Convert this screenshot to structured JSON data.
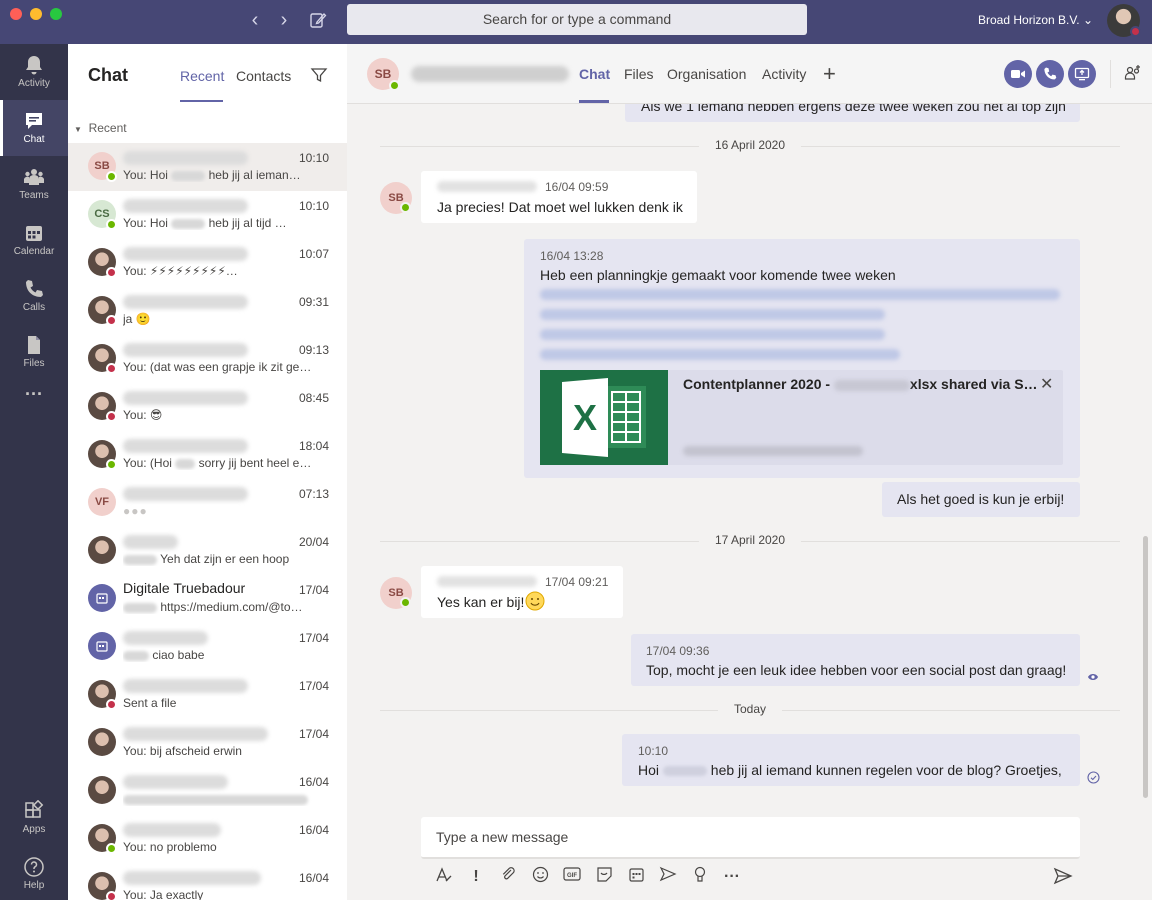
{
  "titlebar": {
    "search_placeholder": "Search for or type a command",
    "org_name": "Broad Horizon B.V.",
    "org_chevron": "⌄"
  },
  "rail": [
    {
      "label": "Activity",
      "icon": "bell-icon"
    },
    {
      "label": "Chat",
      "icon": "chat-icon",
      "active": true
    },
    {
      "label": "Teams",
      "icon": "teams-icon"
    },
    {
      "label": "Calendar",
      "icon": "calendar-icon"
    },
    {
      "label": "Calls",
      "icon": "phone-icon"
    },
    {
      "label": "Files",
      "icon": "file-icon"
    },
    {
      "label": "···",
      "icon": "more-icon"
    },
    {
      "label": "Apps",
      "icon": "apps-icon"
    },
    {
      "label": "Help",
      "icon": "help-icon"
    }
  ],
  "listpane": {
    "title": "Chat",
    "tabs": [
      "Recent",
      "Contacts"
    ],
    "section": "Recent",
    "chats": [
      {
        "avatar": "SB",
        "presence": "ok",
        "time": "10:10",
        "preview": "You: Hoi ",
        "preview_tail": " heb jij al ieman…",
        "active": true
      },
      {
        "avatar": "CS",
        "presence": "ok",
        "time": "10:10",
        "preview": "You: Hoi ",
        "preview_tail": " heb jij al tijd …"
      },
      {
        "avatar": "",
        "presence": "busy",
        "time": "10:07",
        "preview": "You: ⚡⚡⚡⚡⚡⚡⚡⚡⚡…"
      },
      {
        "avatar": "",
        "presence": "busy",
        "time": "09:31",
        "preview": "ja 🙂"
      },
      {
        "avatar": "",
        "presence": "busy",
        "time": "09:13",
        "preview": "You: (dat was een grapje ik zit ge…"
      },
      {
        "avatar": "",
        "presence": "busy",
        "time": "08:45",
        "preview": "You: 😎"
      },
      {
        "avatar": "",
        "presence": "ok",
        "time": "18:04",
        "preview": "You: (Hoi ",
        "preview_tail": " sorry jij bent heel e…"
      },
      {
        "avatar": "VF",
        "presence": "",
        "time": "07:13",
        "preview": "●●●"
      },
      {
        "avatar": "",
        "presence": "",
        "time": "20/04",
        "preview": "",
        "preview_tail": " Yeh dat zijn er een hoop"
      },
      {
        "avatar": "group",
        "presence": "",
        "time": "17/04",
        "name": "Digitale Truebadour",
        "preview": "",
        "preview_tail": " https://medium.com/@to…"
      },
      {
        "avatar": "group",
        "presence": "",
        "time": "17/04",
        "preview": "",
        "preview_tail": " ciao babe"
      },
      {
        "avatar": "",
        "presence": "busy",
        "time": "17/04",
        "preview": "Sent a file"
      },
      {
        "avatar": "",
        "presence": "",
        "time": "17/04",
        "preview": "You: bij afscheid erwin"
      },
      {
        "avatar": "",
        "presence": "",
        "time": "16/04",
        "preview": ""
      },
      {
        "avatar": "",
        "presence": "ok",
        "time": "16/04",
        "preview": "You: no problemo"
      },
      {
        "avatar": "",
        "presence": "busy",
        "time": "16/04",
        "preview": "You: Ja exactly"
      }
    ]
  },
  "conversation": {
    "avatar": "SB",
    "tabs": [
      "Chat",
      "Files",
      "Organisation",
      "Activity"
    ],
    "top_partial": "Als we 1 iemand hebben ergens deze twee weken zou het al top zijn",
    "date1": "16 April 2020",
    "msg1": {
      "time": "16/04 09:59",
      "text": "Ja precies! Dat moet wel lukken denk ik"
    },
    "msg2": {
      "time": "16/04 13:28",
      "text": "Heb een planningkje gemaakt voor komende twee weken",
      "file_prefix": "Contentplanner 2020 - ",
      "file_suffix": "xlsx shared via S…",
      "close": "✕"
    },
    "msg3": {
      "text": "Als het goed is kun je erbij!"
    },
    "date2": "17 April 2020",
    "msg4": {
      "time": "17/04 09:21",
      "text": "Yes kan er bij! "
    },
    "msg5": {
      "time": "17/04 09:36",
      "text": "Top, mocht je een leuk idee hebben voor een social post dan graag!"
    },
    "date3": "Today",
    "msg6": {
      "time": "10:10",
      "text_a": "Hoi ",
      "text_b": " heb jij al iemand kunnen regelen voor de blog? Groetjes,"
    }
  },
  "compose": {
    "placeholder": "Type a new message"
  },
  "colors": {
    "accent": "#6264a7",
    "titlebar": "#464775",
    "rail": "#33344a",
    "excel": "#1e7145"
  }
}
